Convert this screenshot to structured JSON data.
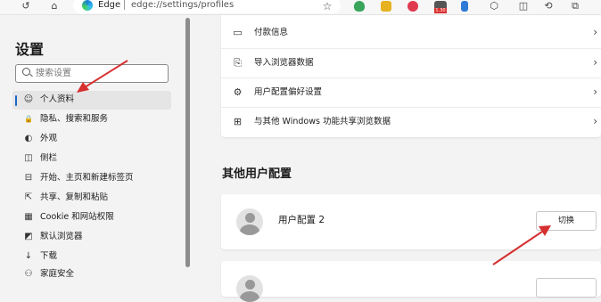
{
  "toolbar": {
    "back_icon": "↺",
    "home_icon": "⌂",
    "address_app": "Edge",
    "address_url": "edge://settings/profiles",
    "star_icon": "☆",
    "badge_text": "1.30"
  },
  "sidebar": {
    "title": "设置",
    "search_placeholder": "搜索设置",
    "items": [
      {
        "label": "个人资料",
        "icon": "☺"
      },
      {
        "label": "隐私、搜索和服务",
        "icon": "🔒"
      },
      {
        "label": "外观",
        "icon": "◐"
      },
      {
        "label": "侧栏",
        "icon": "◫"
      },
      {
        "label": "开始、主页和新建标签页",
        "icon": "⊟"
      },
      {
        "label": "共享、复制和粘贴",
        "icon": "⇱"
      },
      {
        "label": "Cookie 和网站权限",
        "icon": "▦"
      },
      {
        "label": "默认浏览器",
        "icon": "◩"
      },
      {
        "label": "下载",
        "icon": "↓"
      },
      {
        "label": "家庭安全",
        "icon": "⚇"
      }
    ]
  },
  "main": {
    "rows": [
      {
        "label": "付款信息",
        "icon": "▭"
      },
      {
        "label": "导入浏览器数据",
        "icon": "⎘"
      },
      {
        "label": "用户配置偏好设置",
        "icon": "⚙"
      },
      {
        "label": "与其他 Windows 功能共享浏览数据",
        "icon": "⊞"
      }
    ],
    "chevron": "›",
    "section_title": "其他用户配置",
    "profiles": [
      {
        "name": "用户配置 2",
        "button": "切换"
      }
    ]
  },
  "colors": {
    "accent": "#1a66c9",
    "arrow": "#d62f2f"
  }
}
